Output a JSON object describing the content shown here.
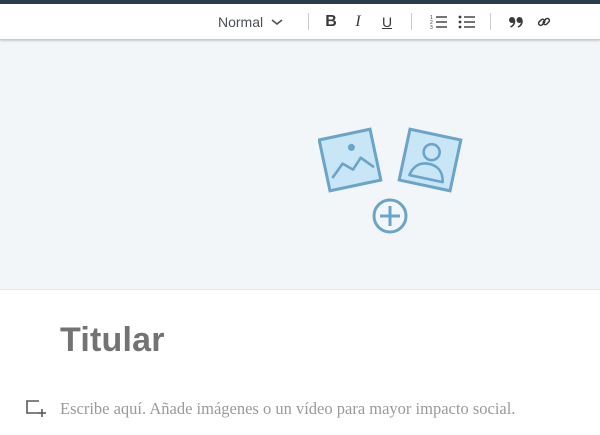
{
  "toolbar": {
    "style_select": {
      "value": "Normal",
      "icon": "chevron-down-icon"
    },
    "bold_label": "B",
    "italic_label": "I",
    "underline_label": "U",
    "icons": [
      "ordered-list-icon",
      "unordered-list-icon",
      "quote-icon",
      "link-icon"
    ]
  },
  "cover": {
    "icon": "add-image-icon",
    "colors": {
      "stroke": "#6aa4c8",
      "fill": "#c8e6f5",
      "background": "#f3f6f8"
    }
  },
  "article": {
    "title_placeholder": "Titular",
    "body_placeholder": "Escribe aquí. Añade imágenes o un vídeo para mayor impacto social.",
    "media_icon": "add-media-icon"
  },
  "colors": {
    "top_strip": "#283e4a",
    "title_text": "#737373",
    "placeholder_text": "#9a9a9a"
  }
}
